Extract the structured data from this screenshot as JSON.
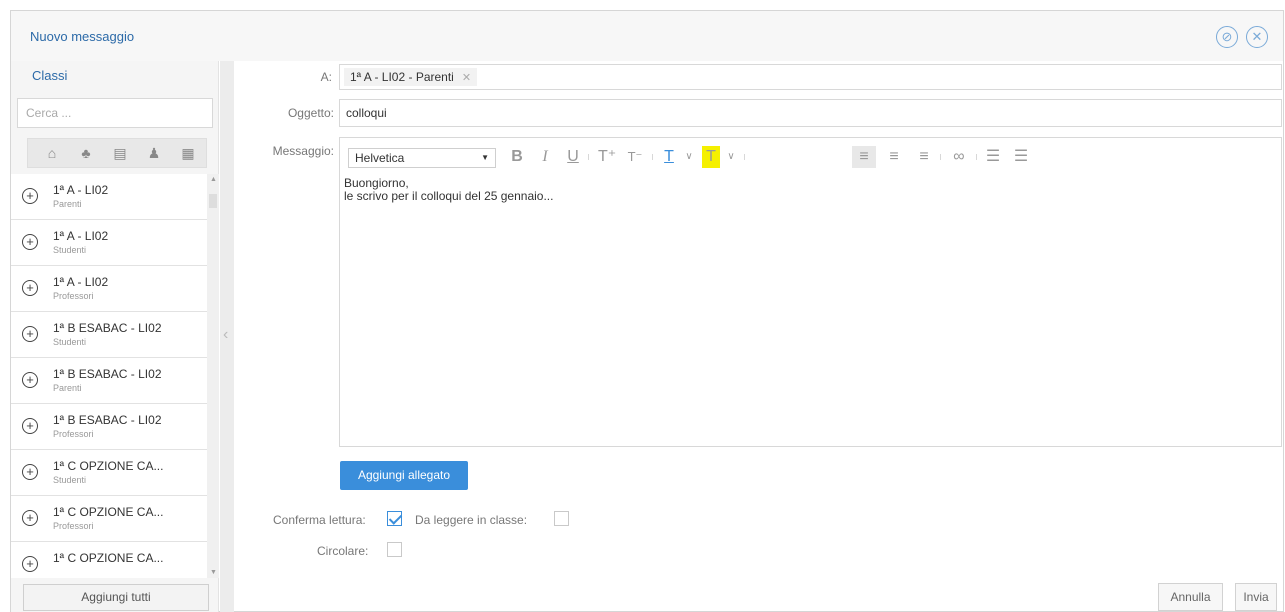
{
  "header": {
    "title": "Nuovo messaggio"
  },
  "sidebar": {
    "title": "Classi",
    "search_placeholder": "Cerca ...",
    "items": [
      {
        "name": "1ª A - LI02",
        "sub": "Parenti"
      },
      {
        "name": "1ª A - LI02",
        "sub": "Studenti"
      },
      {
        "name": "1ª A - LI02",
        "sub": "Professori"
      },
      {
        "name": "1ª B ESABAC - LI02",
        "sub": "Studenti"
      },
      {
        "name": "1ª B ESABAC - LI02",
        "sub": "Parenti"
      },
      {
        "name": "1ª B ESABAC - LI02",
        "sub": "Professori"
      },
      {
        "name": "1ª C OPZIONE CA...",
        "sub": "Studenti"
      },
      {
        "name": "1ª C OPZIONE CA...",
        "sub": "Professori"
      },
      {
        "name": "1ª C OPZIONE CA...",
        "sub": ""
      }
    ],
    "add_all": "Aggiungi tutti"
  },
  "form": {
    "to_label": "A:",
    "to_chip": "1ª A - LI02 - Parenti",
    "subject_label": "Oggetto:",
    "subject_value": "colloqui",
    "message_label": "Messaggio:",
    "font": "Helvetica",
    "body_line1": "Buongiorno,",
    "body_line2": "le scrivo per il colloqui del 25 gennaio...",
    "attach_button": "Aggiungi allegato",
    "confirm_read_label": "Conferma lettura:",
    "confirm_read_checked": true,
    "read_in_class_label": "Da leggere in classe:",
    "read_in_class_checked": false,
    "circular_label": "Circolare:",
    "circular_checked": false
  },
  "footer": {
    "cancel": "Annulla",
    "send": "Invia"
  },
  "colors": {
    "accent": "#3a8edb",
    "title": "#2c6aa8",
    "highlight": "#f5f000"
  }
}
